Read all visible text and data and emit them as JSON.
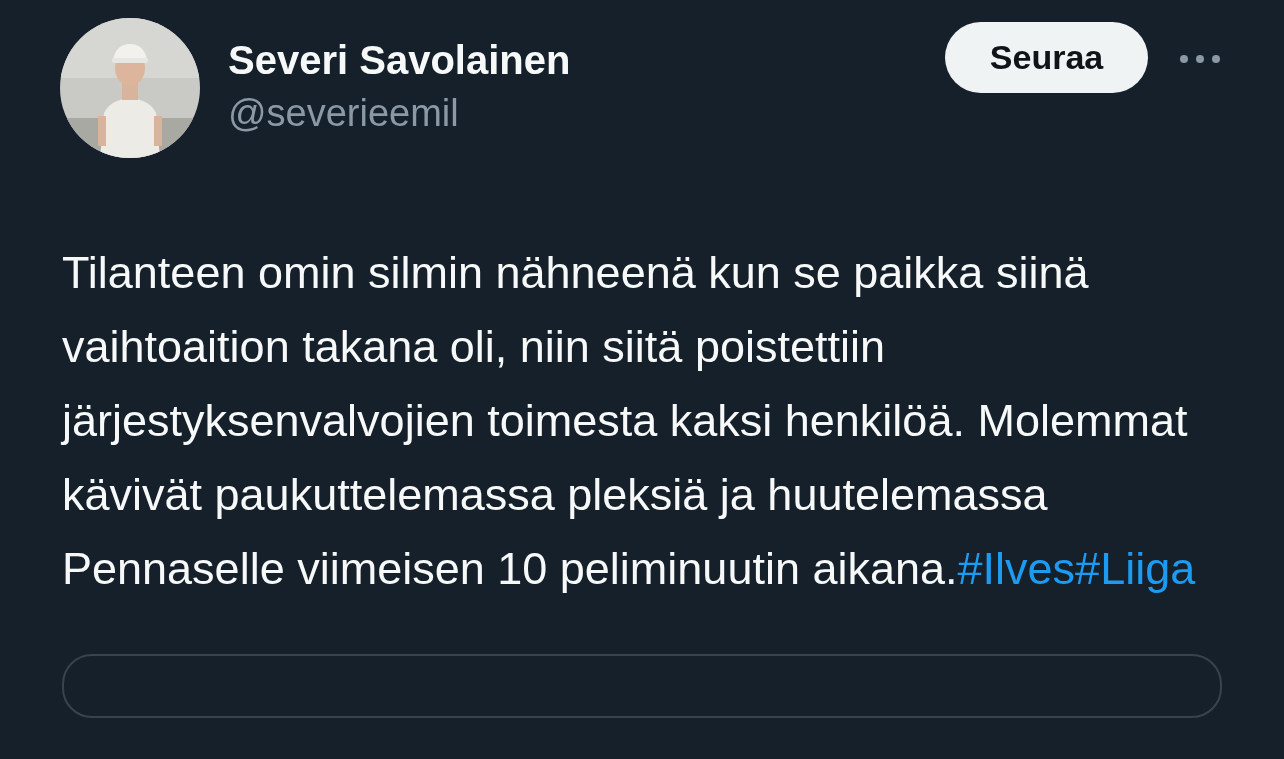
{
  "author": {
    "name": "Severi Savolainen",
    "handle": "@severieemil"
  },
  "follow_button": {
    "label": "Seuraa"
  },
  "tweet": {
    "text": "Tilanteen omin silmin nähneenä kun se paikka siinä vaihtoaition takana oli, niin siitä poistettiin järjestyksenvalvojien toimesta kaksi henkilöä. Molemmat kävivät paukuttelemassa pleksiä ja huutelemassa Pennaselle viimeisen 10 peliminuutin aikana.",
    "hashtags": [
      "#Ilves",
      "#Liiga"
    ]
  }
}
